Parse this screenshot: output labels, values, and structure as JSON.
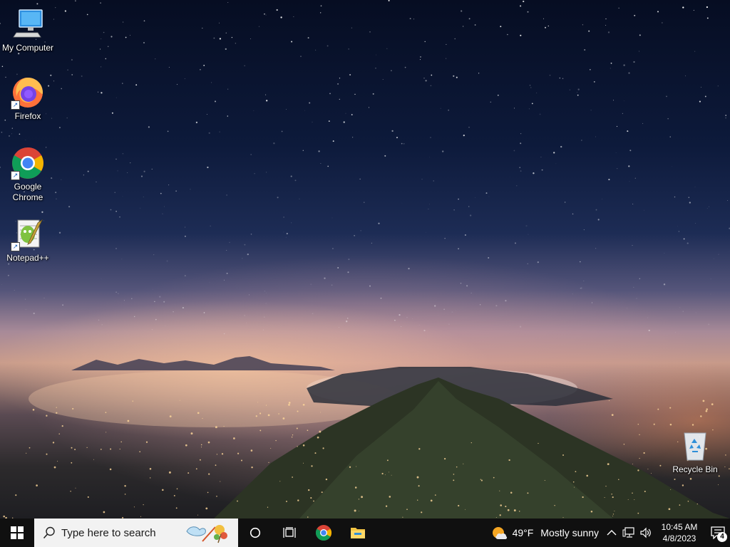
{
  "desktop": {
    "icons": [
      {
        "name": "my-computer",
        "label": "My Computer"
      },
      {
        "name": "firefox",
        "label": "Firefox"
      },
      {
        "name": "google-chrome",
        "label": "Google Chrome"
      },
      {
        "name": "notepad-plus-plus",
        "label": "Notepad++"
      },
      {
        "name": "recycle-bin",
        "label": "Recycle Bin"
      }
    ]
  },
  "taskbar": {
    "search_placeholder": "Type here to search",
    "pinned": [
      "cortana-icon",
      "task-view-icon",
      "chrome-icon",
      "file-explorer-icon"
    ],
    "weather": {
      "temp": "49°F",
      "condition": "Mostly sunny"
    },
    "clock": {
      "time": "10:45 AM",
      "date": "4/8/2023"
    },
    "notification_count": "4"
  },
  "colors": {
    "taskbar": "#101010",
    "search_bg": "#f2f2f2",
    "accent": "#1a73e8"
  }
}
